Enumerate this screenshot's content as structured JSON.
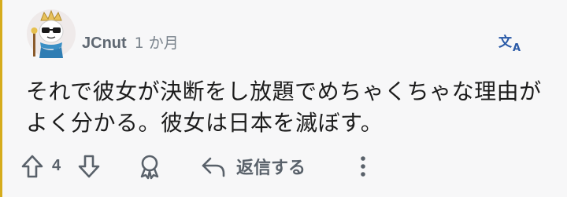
{
  "comment": {
    "author": "JCnut",
    "timestamp": "1 か月",
    "body": "それで彼女が決断をし放題でめちゃくちゃな理由がよく分かる。彼女は日本を滅ぼす。"
  },
  "actions": {
    "upvote_icon": "arrow-up-icon",
    "vote_count": "4",
    "downvote_icon": "arrow-down-icon",
    "award_icon": "award-icon",
    "reply_icon": "reply-arrow-icon",
    "reply_label": "返信する",
    "more_icon": "more-vertical-icon"
  },
  "header": {
    "translate_icon": "translate-icon"
  },
  "colors": {
    "accent_translate": "#2a5aa7",
    "thread_rule": "#d6ac1c",
    "icon_gray": "#59616a"
  }
}
